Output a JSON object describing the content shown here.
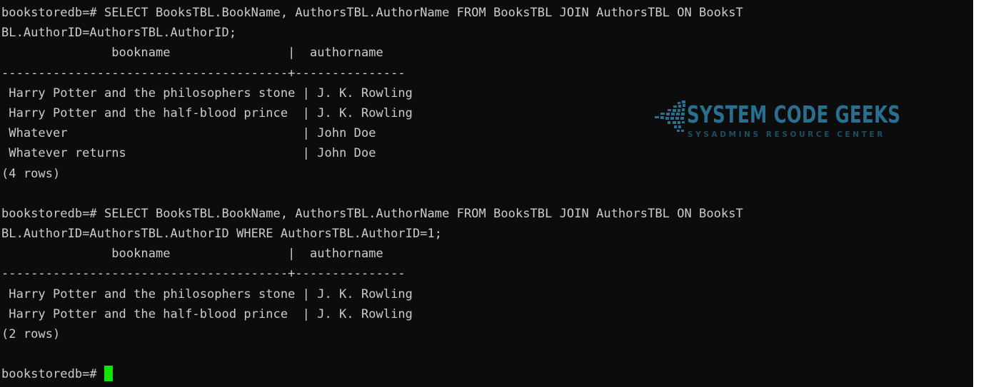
{
  "terminal": {
    "lines": [
      "bookstoredb=# SELECT BooksTBL.BookName, AuthorsTBL.AuthorName FROM BooksTBL JOIN AuthorsTBL ON BooksT",
      "BL.AuthorID=AuthorsTBL.AuthorID;",
      "               bookname                |  authorname",
      "---------------------------------------+---------------",
      " Harry Potter and the philosophers stone | J. K. Rowling",
      " Harry Potter and the half-blood prince  | J. K. Rowling",
      " Whatever                                | John Doe",
      " Whatever returns                        | John Doe",
      "(4 rows)",
      "",
      "bookstoredb=# SELECT BooksTBL.BookName, AuthorsTBL.AuthorName FROM BooksTBL JOIN AuthorsTBL ON BooksT",
      "BL.AuthorID=AuthorsTBL.AuthorID WHERE AuthorsTBL.AuthorID=1;",
      "               bookname                |  authorname",
      "---------------------------------------+---------------",
      " Harry Potter and the philosophers stone | J. K. Rowling",
      " Harry Potter and the half-blood prince  | J. K. Rowling",
      "(2 rows)",
      ""
    ],
    "prompt": "bookstoredb=# ",
    "cursor_color": "#13e100",
    "background": "#0c0c0c",
    "foreground": "#cccccc"
  },
  "watermark": {
    "title": "SYSTEM CODE GEEKS",
    "subtitle": "SYSADMINS RESOURCE CENTER",
    "icon": "dotted-arrow-logo-icon",
    "color": "#2a6f8e"
  }
}
